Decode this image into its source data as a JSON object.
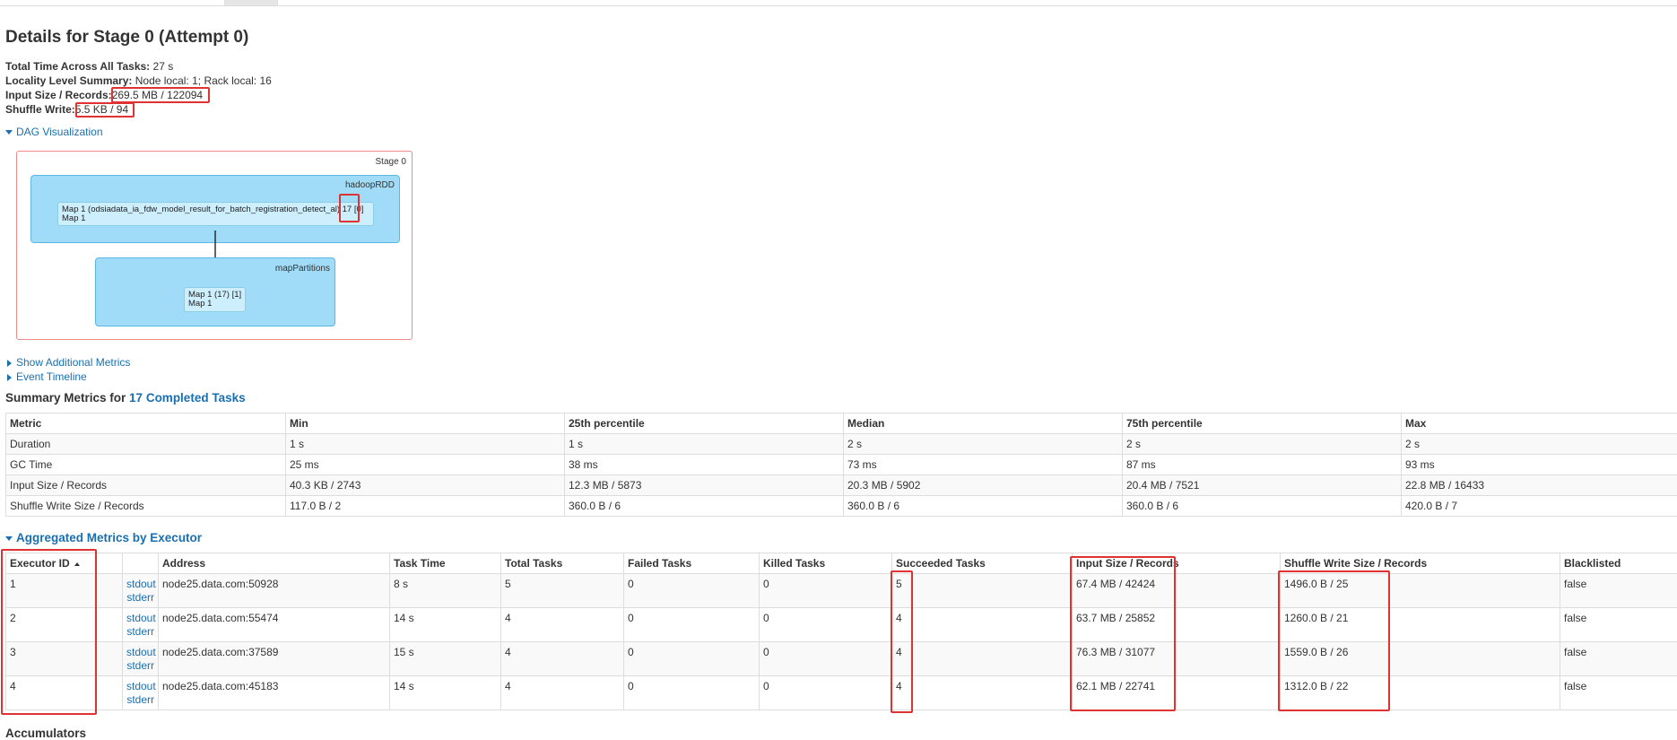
{
  "page": {
    "title": "Details for Stage 0 (Attempt 0)"
  },
  "summary": {
    "total_time_label": "Total Time Across All Tasks:",
    "total_time_value": "27 s",
    "locality_label": "Locality Level Summary:",
    "locality_value": "Node local: 1; Rack local: 16",
    "input_label": "Input Size / Records:",
    "input_value": "269.5 MB / 122094",
    "shuffle_label": "Shuffle Write:",
    "shuffle_value": "5.5 KB / 94"
  },
  "toggles": {
    "dag": "DAG Visualization",
    "additional_metrics": "Show Additional Metrics",
    "event_timeline": "Event Timeline",
    "aggregated": "Aggregated Metrics by Executor"
  },
  "dag": {
    "stage_label": "Stage 0",
    "cluster1_label": "hadoopRDD",
    "node1_line1": "Map 1 (odsiadata_ia_fdw_model_result_for_batch_registration_detect_al) 17 [0]",
    "node1_line2": "Map 1",
    "cluster2_label": "mapPartitions",
    "node2_line1": "Map 1 (17) [1]",
    "node2_line2": "Map 1"
  },
  "summary_metrics": {
    "title_prefix": "Summary Metrics for ",
    "title_link": "17 Completed Tasks",
    "headers": [
      "Metric",
      "Min",
      "25th percentile",
      "Median",
      "75th percentile",
      "Max"
    ],
    "rows": [
      [
        "Duration",
        "1 s",
        "1 s",
        "2 s",
        "2 s",
        "2 s"
      ],
      [
        "GC Time",
        "25 ms",
        "38 ms",
        "73 ms",
        "87 ms",
        "93 ms"
      ],
      [
        "Input Size / Records",
        "40.3 KB / 2743",
        "12.3 MB / 5873",
        "20.3 MB / 5902",
        "20.4 MB / 7521",
        "22.8 MB / 16433"
      ],
      [
        "Shuffle Write Size / Records",
        "117.0 B / 2",
        "360.0 B / 6",
        "360.0 B / 6",
        "360.0 B / 6",
        "420.0 B / 7"
      ]
    ]
  },
  "executors": {
    "headers": [
      "Executor ID",
      "",
      "Address",
      "Task Time",
      "Total Tasks",
      "Failed Tasks",
      "Killed Tasks",
      "Succeeded Tasks",
      "Input Size / Records",
      "Shuffle Write Size / Records",
      "Blacklisted"
    ],
    "stdout_label": "stdout",
    "stderr_label": "stderr",
    "rows": [
      [
        "1",
        "node25.data.com:50928",
        "8 s",
        "5",
        "0",
        "0",
        "5",
        "67.4 MB / 42424",
        "1496.0 B / 25",
        "false"
      ],
      [
        "2",
        "node25.data.com:55474",
        "14 s",
        "4",
        "0",
        "0",
        "4",
        "63.7 MB / 25852",
        "1260.0 B / 21",
        "false"
      ],
      [
        "3",
        "node25.data.com:37589",
        "15 s",
        "4",
        "0",
        "0",
        "4",
        "76.3 MB / 31077",
        "1559.0 B / 26",
        "false"
      ],
      [
        "4",
        "node25.data.com:45183",
        "14 s",
        "4",
        "0",
        "0",
        "4",
        "62.1 MB / 22741",
        "1312.0 B / 22",
        "false"
      ]
    ]
  },
  "bottom": {
    "accumulators_title": "Accumulators"
  },
  "colors": {
    "link": "#1a6fb0",
    "highlight": "#e03232",
    "dag_cluster": "#a0dcf7",
    "dag_node": "#cdeefc"
  }
}
